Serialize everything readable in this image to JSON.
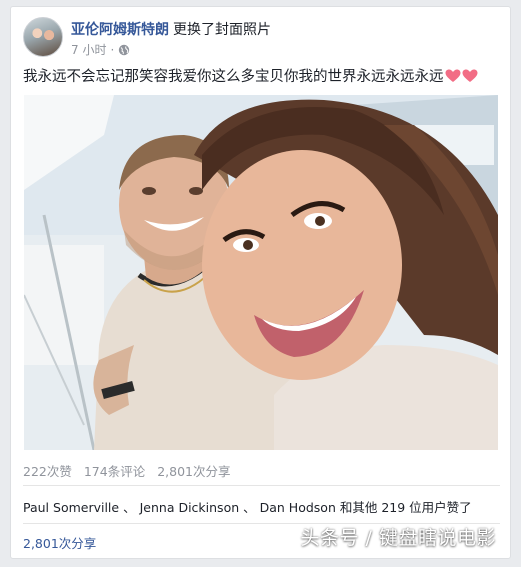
{
  "post": {
    "author": "亚伦阿姆斯特朗",
    "action": "更换了封面照片",
    "time": "7 小时",
    "time_separator": "·",
    "audience_icon": "globe-icon",
    "caption": "我永远不会忘记那笑容我爱你这么多宝贝你我的世界永远永远永远",
    "caption_emoji": [
      "heart-icon",
      "heart-icon"
    ]
  },
  "stats": {
    "likes": "222次赞",
    "comments": "174条评论",
    "shares": "2,801次分享"
  },
  "likers": {
    "names": [
      "Paul Somerville",
      "Jenna Dickinson",
      "Dan Hodson"
    ],
    "separator": "、",
    "suffix": "和其他 219 位用户赞了"
  },
  "shares_link": "2,801次分享",
  "watermark": "头条号 / 键盘瞎说电影",
  "colors": {
    "link_blue": "#365899",
    "meta_gray": "#90949c",
    "heart": "#f26d85"
  }
}
